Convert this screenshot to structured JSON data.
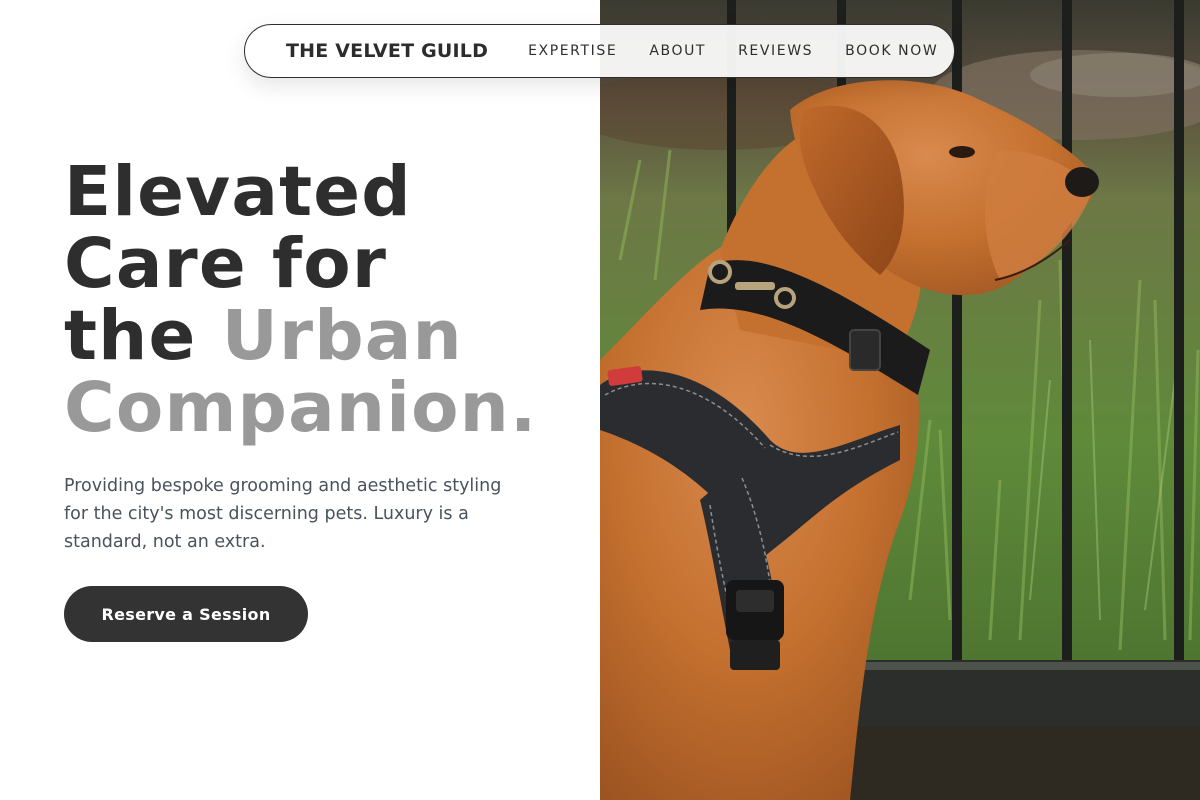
{
  "nav": {
    "brand": "THE VELVET GUILD",
    "links": [
      {
        "label": "EXPERTISE"
      },
      {
        "label": "ABOUT"
      },
      {
        "label": "REVIEWS"
      },
      {
        "label": "BOOK NOW"
      }
    ]
  },
  "hero": {
    "headline_line1": "Elevated",
    "headline_line2": "Care for",
    "headline_line3_dark": "the",
    "headline_line3_muted": "Urban",
    "headline_line4_muted": "Companion.",
    "subcopy": "Providing bespoke grooming and aesthetic styling for the city's most discerning pets. Luxury is a standard, not an extra.",
    "cta_label": "Reserve a Session",
    "image_alt": "Red retriever dog wearing a black collar and harness sitting beside a black iron fence on grass"
  },
  "colors": {
    "text_dark": "#2e2e2e",
    "text_muted": "#999999",
    "button_bg": "#333333",
    "button_text": "#ffffff",
    "body_text": "#4a525c"
  }
}
